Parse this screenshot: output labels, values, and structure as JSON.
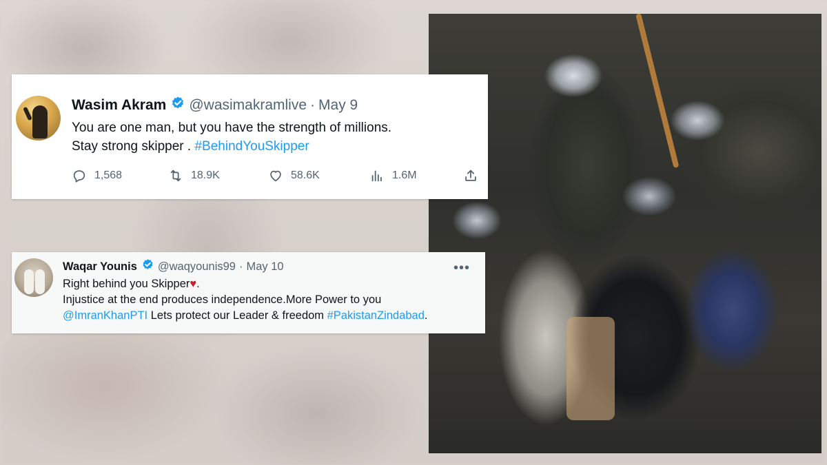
{
  "tweets": [
    {
      "name": "Wasim Akram",
      "handle": "@wasimakramlive",
      "separator": "·",
      "date": "May 9",
      "line1": "You are one man, but you have the strength of millions.",
      "line2_text": "Stay strong skipper . ",
      "line2_hashtag": "#BehindYouSkipper",
      "stats": {
        "replies": "1,568",
        "retweets": "18.9K",
        "likes": "58.6K",
        "views": "1.6M"
      }
    },
    {
      "name": "Waqar Younis",
      "handle": "@waqyounis99",
      "separator": "·",
      "date": "May 10",
      "more": "•••",
      "line1_text": "Right behind you Skipper",
      "heart": "♥",
      "line1_end": ".",
      "line2": "Injustice at the end produces independence.More Power to you",
      "line3_mention": "@ImranKhanPTI",
      "line3_text": " Lets protect our Leader & freedom ",
      "line3_hashtag": "#PakistanZindabad",
      "line3_end": "."
    }
  ],
  "colors": {
    "link": "#1d9bf0",
    "muted": "#536471",
    "text": "#0f1419",
    "heart": "#c9212b"
  },
  "icons": [
    "verified-badge-icon",
    "reply-icon",
    "retweet-icon",
    "like-icon",
    "views-icon",
    "share-icon",
    "more-icon"
  ]
}
